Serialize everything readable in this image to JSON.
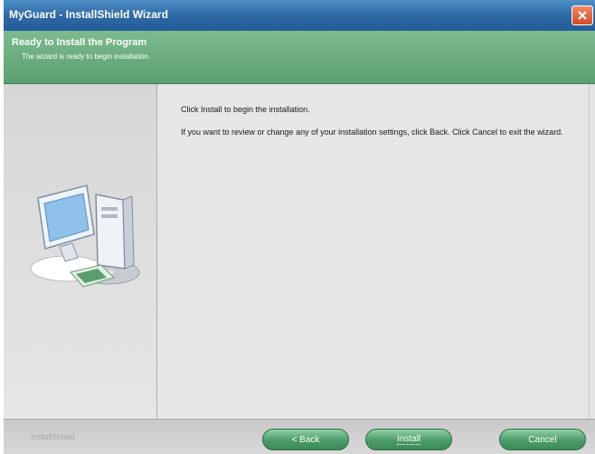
{
  "window": {
    "title": "MyGuard - InstallShield Wizard"
  },
  "header": {
    "title": "Ready to Install the Program",
    "subtitle": "The wizard is ready to begin installation."
  },
  "content": {
    "line1": "Click Install to begin the installation.",
    "line2": "If you want to review or change any of your installation settings, click Back. Click Cancel to exit the wizard."
  },
  "footer": {
    "brand": "InstallShield",
    "back_label": "< Back",
    "install_label": "Install",
    "cancel_label": "Cancel"
  },
  "colors": {
    "titlebar": "#2f6aa6",
    "header_band": "#6aa97d",
    "button": "#4c9c68",
    "close": "#d24a25"
  },
  "icons": {
    "close": "close-icon",
    "illustration": "computer-installer-illustration"
  }
}
